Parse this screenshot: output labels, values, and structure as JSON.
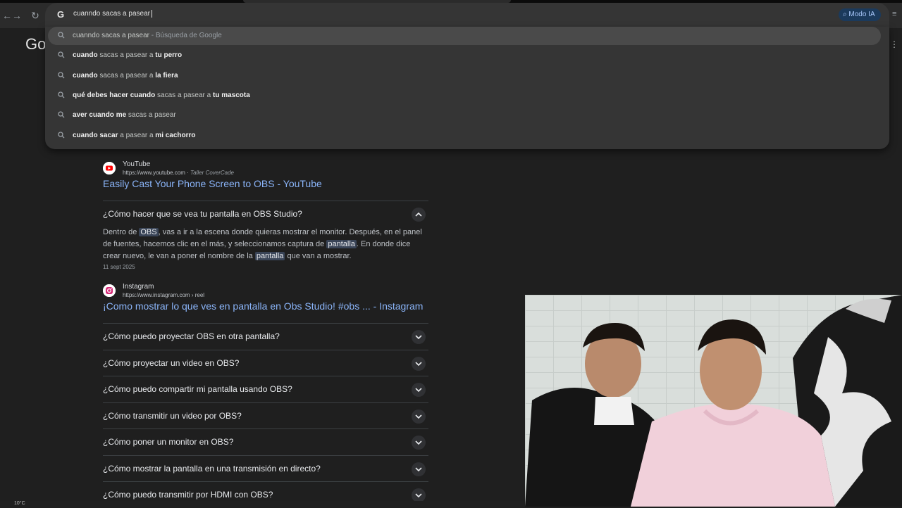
{
  "browser": {
    "omnibox": {
      "value": "cuanndo sacas a pasear",
      "engine_icon": "google-g-icon"
    },
    "modo_ia": {
      "label": "Modo IA",
      "icon": "search-sparkle-icon"
    }
  },
  "suggestions": [
    {
      "parts": [
        {
          "t": "cuanndo sacas a pasear",
          "b": false
        },
        {
          "t": " - Búsqueda de Google",
          "muted": true
        }
      ]
    },
    {
      "parts": [
        {
          "t": "cuando",
          "b": true
        },
        {
          "t": " sacas a pasear a ",
          "b": false
        },
        {
          "t": "tu perro",
          "b": true
        }
      ]
    },
    {
      "parts": [
        {
          "t": "cuando",
          "b": true
        },
        {
          "t": " sacas a pasear a ",
          "b": false
        },
        {
          "t": "la fiera",
          "b": true
        }
      ]
    },
    {
      "parts": [
        {
          "t": "qué debes hacer cuando",
          "b": true
        },
        {
          "t": " sacas a pasear a ",
          "b": false
        },
        {
          "t": "tu mascota",
          "b": true
        }
      ]
    },
    {
      "parts": [
        {
          "t": "aver cuando me",
          "b": true
        },
        {
          "t": " sacas a pasear",
          "b": false
        }
      ]
    },
    {
      "parts": [
        {
          "t": "cuando sacar",
          "b": true
        },
        {
          "t": " a pasear a ",
          "b": false
        },
        {
          "t": "mi cachorro",
          "b": true
        }
      ]
    }
  ],
  "results": {
    "youtube": {
      "source": "YouTube",
      "url": "https://www.youtube.com",
      "channel": "Taller CoverCade",
      "title": "Easily Cast Your Phone Screen to OBS - YouTube"
    },
    "faq_open": {
      "question": "¿Cómo hacer que se vea tu pantalla en OBS Studio?",
      "answer_parts": [
        {
          "t": "Dentro de "
        },
        {
          "t": "OBS",
          "hl": true
        },
        {
          "t": ", vas a ir a la escena donde quieras mostrar el monitor. Después, en el panel de fuentes, hacemos clic en el más, y seleccionamos captura de "
        },
        {
          "t": "pantalla",
          "hl": true
        },
        {
          "t": ". En donde dice crear nuevo, le van a poner el nombre de la "
        },
        {
          "t": "pantalla",
          "hl": true
        },
        {
          "t": " que van a mostrar."
        }
      ],
      "date": "11 sept 2025"
    },
    "instagram": {
      "source": "Instagram",
      "url": "https://www.instagram.com",
      "path": " › reel",
      "title": "¡Como mostrar lo que ves en pantalla en Obs Studio! #obs ... - Instagram"
    },
    "faqs": [
      "¿Cómo puedo proyectar OBS en otra pantalla?",
      "¿Cómo proyectar un video en OBS?",
      "¿Cómo puedo compartir mi pantalla usando OBS?",
      "¿Cómo transmitir un video por OBS?",
      "¿Cómo poner un monitor en OBS?",
      "¿Cómo mostrar la pantalla en una transmisión en directo?",
      "¿Cómo puedo transmitir por HDMI con OBS?"
    ]
  },
  "background": {
    "logo_partial": "Go"
  },
  "taskbar": {
    "temperature": "10°C"
  },
  "colors": {
    "link": "#8ab4f8",
    "background": "#1f1f1f",
    "omnibox": "#353535",
    "accent_pill": "#1b3a5c"
  }
}
